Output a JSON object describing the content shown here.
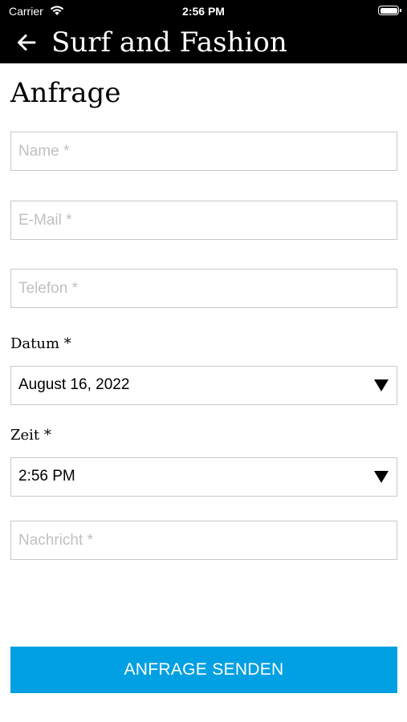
{
  "status_bar": {
    "carrier": "Carrier",
    "time": "2:56 PM"
  },
  "header": {
    "back_icon": "arrow-left-icon",
    "title": "Surf and Fashion"
  },
  "form": {
    "heading": "Anfrage",
    "name_placeholder": "Name *",
    "email_placeholder": "E-Mail *",
    "phone_placeholder": "Telefon *",
    "date_label": "Datum *",
    "date_value": "August 16, 2022",
    "time_label": "Zeit *",
    "time_value": "2:56 PM",
    "message_placeholder": "Nachricht *",
    "submit_label": "ANFRAGE SENDEN"
  },
  "colors": {
    "header_bg": "#000000",
    "button_bg": "#00a0e2",
    "field_border": "#c8c8c8",
    "placeholder": "#c0c0c0"
  }
}
